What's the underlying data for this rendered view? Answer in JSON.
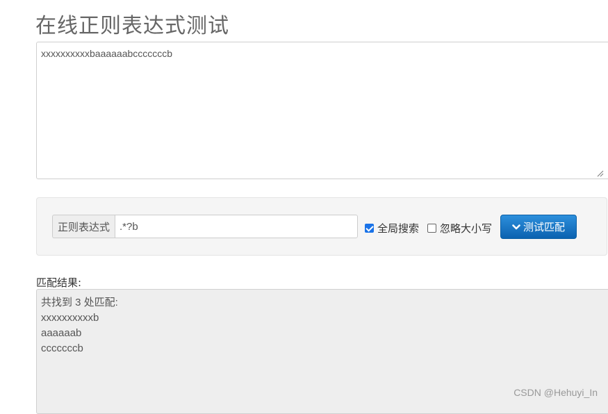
{
  "page": {
    "title": "在线正则表达式测试"
  },
  "source_text": "xxxxxxxxxxbaaaaaabcccccccb",
  "regex": {
    "addon_label": "正则表达式",
    "value": ".*?b"
  },
  "options": {
    "global": {
      "label": "全局搜索",
      "checked": true
    },
    "ignore_case": {
      "label": "忽略大小写",
      "checked": false
    }
  },
  "test_button": {
    "label": "测试匹配",
    "icon": "chevron-down-icon"
  },
  "result": {
    "label": "匹配结果:",
    "summary": "共找到 3 处匹配:",
    "matches": [
      "xxxxxxxxxxb",
      "aaaaaab",
      "cccccccb"
    ]
  },
  "watermark": "CSDN @Hehuyi_In",
  "colors": {
    "button": "#0b62b0",
    "checkbox": "#1a73e8",
    "result_bg": "#eeeeee"
  }
}
